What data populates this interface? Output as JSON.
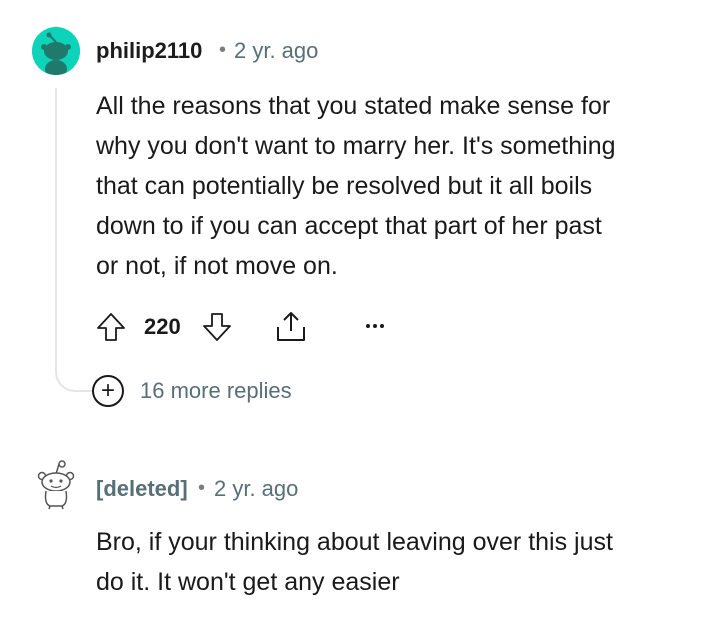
{
  "comments": [
    {
      "username": "philip2110",
      "separator": "•",
      "time_ago": "2 yr. ago",
      "lines": [
        "All the reasons that you stated make sense for",
        "why you don't want to marry her. It's something",
        "that can potentially be resolved but it all boils",
        "down to if you can accept that part of her past",
        "or not, if not move on."
      ],
      "score": "220",
      "more_replies": "16 more replies",
      "avatar_color": "#0dd3bb"
    },
    {
      "username": "[deleted]",
      "separator": "•",
      "time_ago": "2 yr. ago",
      "lines": [
        "Bro, if your thinking about leaving over this just",
        "do it. It won't get any easier"
      ]
    }
  ],
  "icons": {
    "upvote": "arrow-up-icon",
    "downvote": "arrow-down-icon",
    "share": "share-icon",
    "more": "more-options-icon",
    "expand": "plus-icon"
  },
  "colors": {
    "meta_text": "#576f76",
    "thread_line": "#e5e5e5",
    "icon_stroke": "#1a1a1b"
  }
}
